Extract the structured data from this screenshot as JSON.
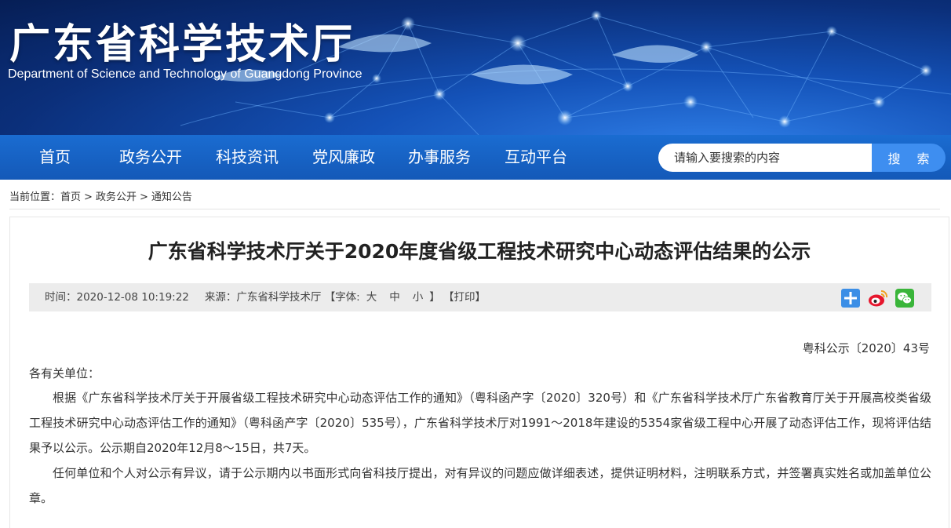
{
  "header": {
    "title": "广东省科学技术厅",
    "subtitle": "Department of Science and Technology of Guangdong Province"
  },
  "nav": {
    "items": [
      {
        "label": "首页"
      },
      {
        "label": "政务公开"
      },
      {
        "label": "科技资讯"
      },
      {
        "label": "党风廉政"
      },
      {
        "label": "办事服务"
      },
      {
        "label": "互动平台"
      }
    ],
    "search_placeholder": "请输入要搜索的内容",
    "search_button": "搜 索"
  },
  "breadcrumb": {
    "prefix": "当前位置：",
    "items": [
      "首页",
      "政务公开",
      "通知公告"
    ],
    "separator": ">"
  },
  "article": {
    "title": "广东省科学技术厅关于2020年度省级工程技术研究中心动态评估结果的公示",
    "meta": {
      "time_label": "时间：",
      "time": "2020-12-08 10:19:22",
      "source_label": "来源：",
      "source": "广东省科学技术厅",
      "font_open": "【字体:",
      "font_large": "大",
      "font_medium": "中",
      "font_small": "小",
      "font_close": "】",
      "print": "【打印】"
    },
    "share_icons": [
      "add-share-icon",
      "weibo-icon",
      "wechat-icon"
    ],
    "doc_number": "粤科公示〔2020〕43号",
    "salutation": "各有关单位：",
    "paragraphs": [
      "根据《广东省科学技术厅关于开展省级工程技术研究中心动态评估工作的通知》（粤科函产字〔2020〕320号）和《广东省科学技术厅广东省教育厅关于开展高校类省级工程技术研究中心动态评估工作的通知》（粤科函产字〔2020〕535号），广东省科学技术厅对1991～2018年建设的5354家省级工程中心开展了动态评估工作，现将评估结果予以公示。公示期自2020年12月8～15日，共7天。",
      "任何单位和个人对公示有异议，请于公示期内以书面形式向省科技厅提出，对有异议的问题应做详细表述，提供证明材料，注明联系方式，并签署真实姓名或加盖单位公章。"
    ]
  },
  "colors": {
    "nav_bg": "#1a6cd1",
    "search_btn": "#3e8ef0",
    "meta_bg": "#ececec"
  }
}
